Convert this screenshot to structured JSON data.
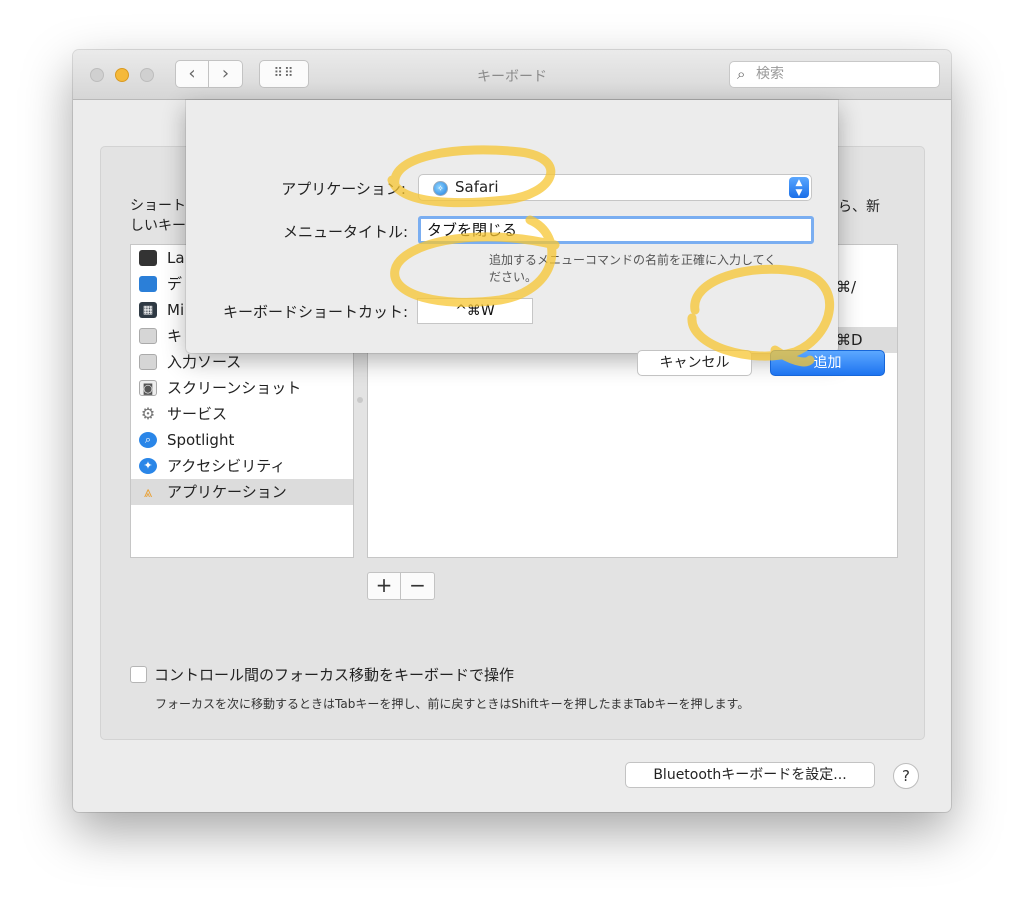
{
  "window": {
    "title": "キーボード",
    "nav_back_icon": "chevron-left-icon",
    "nav_forward_icon": "chevron-right-icon",
    "grid_icon": "grid-icon",
    "search_placeholder": "検索"
  },
  "panel": {
    "desc_left_line1": "ショート",
    "desc_left_line2": "しいキー",
    "desc_right": "ら、新",
    "sidebar": [
      {
        "label": "La",
        "icon": "laptop-keyboard-icon",
        "color": "#333333"
      },
      {
        "label": "デ",
        "icon": "display-icon",
        "color": "#2b7fd8"
      },
      {
        "label": "Mi",
        "icon": "mission-control-icon",
        "color": "#2f3a44"
      },
      {
        "label": "キ",
        "icon": "keyboard-icon",
        "color": "#cfcfcf"
      },
      {
        "label": "入力ソース",
        "icon": "keyboard-icon",
        "color": "#cfcfcf"
      },
      {
        "label": "スクリーンショット",
        "icon": "screenshot-icon",
        "color": "#e0e0e0"
      },
      {
        "label": "サービス",
        "icon": "gear-icon",
        "color": "#8a8a8a"
      },
      {
        "label": "Spotlight",
        "icon": "spotlight-icon",
        "color": "#2a86e8"
      },
      {
        "label": "アクセシビリティ",
        "icon": "accessibility-icon",
        "color": "#2a86e8"
      },
      {
        "label": "アプリケーション",
        "icon": "app-store-icon",
        "color": "#e8a23a"
      }
    ],
    "list_fragment_1": "⌘/",
    "list_fragment_2": "⌘D",
    "plus_label": "+",
    "minus_label": "−",
    "checkbox_label": "コントロール間のフォーカス移動をキーボードで操作",
    "checkbox_note": "フォーカスを次に移動するときはTabキーを押し、前に戻すときはShiftキーを押したままTabキーを押します。",
    "bluetooth_button": "Bluetoothキーボードを設定...",
    "help_button": "?"
  },
  "sheet": {
    "app_label": "アプリケーション:",
    "app_value": "Safari",
    "menu_title_label": "メニュータイトル:",
    "menu_title_value": "タブを閉じる",
    "hint": "追加するメニューコマンドの名前を正確に入力してください。",
    "shortcut_label": "キーボードショートカット:",
    "shortcut_value": "^⌘W",
    "cancel_button": "キャンセル",
    "add_button": "追加"
  },
  "colors": {
    "accent_blue": "#1e74f0",
    "highlighter_yellow": "#f7c531"
  }
}
